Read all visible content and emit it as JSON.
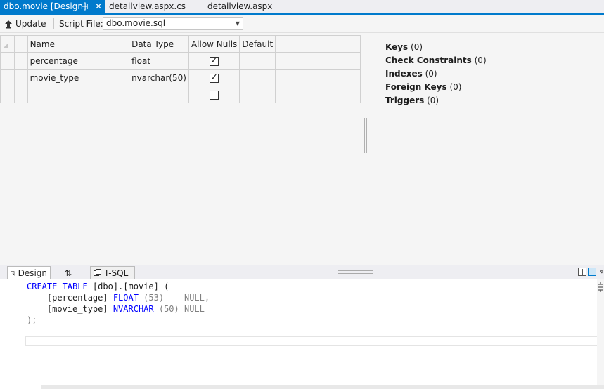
{
  "tabs": [
    {
      "label": "dbo.movie [Design]",
      "pin": "⊣",
      "close": "✕"
    },
    {
      "label": "detailview.aspx.cs"
    },
    {
      "label": "detailview.aspx"
    }
  ],
  "toolbar": {
    "update_label": "Update",
    "script_file_label": "Script File:",
    "script_file_value": "dbo.movie.sql"
  },
  "grid": {
    "headers": [
      "Name",
      "Data Type",
      "Allow Nulls",
      "Default"
    ],
    "rows": [
      {
        "name": "percentage",
        "type": "float",
        "allow_nulls": true,
        "default": ""
      },
      {
        "name": "movie_type",
        "type": "nvarchar(50)",
        "allow_nulls": true,
        "default": ""
      },
      {
        "name": "",
        "type": "",
        "allow_nulls": false,
        "default": ""
      }
    ]
  },
  "properties": [
    {
      "label": "Keys",
      "count": "(0)"
    },
    {
      "label": "Check Constraints",
      "count": "(0)"
    },
    {
      "label": "Indexes",
      "count": "(0)"
    },
    {
      "label": "Foreign Keys",
      "count": "(0)"
    },
    {
      "label": "Triggers",
      "count": "(0)"
    }
  ],
  "bottom_tabs": {
    "design": "Design",
    "swap": "⇅",
    "tsql": "T-SQL"
  },
  "sql": {
    "line1_kw": "CREATE TABLE",
    "line1_rest": " [dbo].[movie] (",
    "line2_col": "    [percentage] ",
    "line2_type": "FLOAT",
    "line2_size": " (53)",
    "line2_null": "    NULL,",
    "line3_col": "    [movie_type] ",
    "line3_type": "NVARCHAR",
    "line3_size": " (50)",
    "line3_null": " NULL",
    "line4": ");"
  },
  "colors": {
    "accent": "#007acc",
    "keyword": "#0000ff",
    "comment_gray": "#808080"
  }
}
